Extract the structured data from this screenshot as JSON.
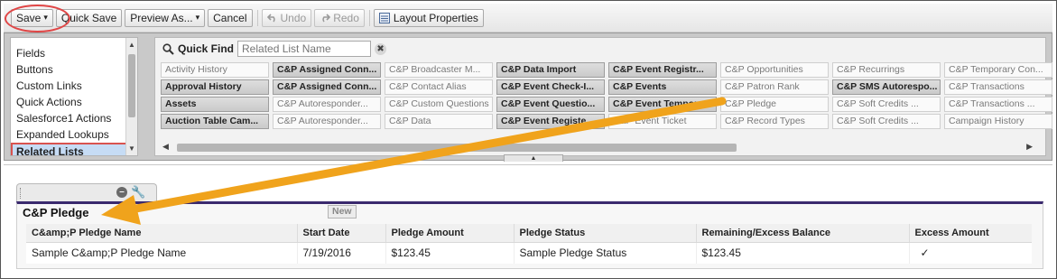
{
  "toolbar": {
    "save": "Save",
    "save_caret": "▾",
    "quick_save": "Quick Save",
    "preview_as": "Preview As...",
    "preview_caret": "▾",
    "cancel": "Cancel",
    "undo": "Undo",
    "redo": "Redo",
    "layout_properties": "Layout Properties"
  },
  "categories": [
    "Fields",
    "Buttons",
    "Custom Links",
    "Quick Actions",
    "Salesforce1 Actions",
    "Expanded Lookups",
    "Related Lists"
  ],
  "selected_category": "Related Lists",
  "quick_find": {
    "label": "Quick Find",
    "placeholder": "Related List Name"
  },
  "related_list_grid": [
    [
      "Activity History",
      "Approval History",
      "Assets",
      "Auction Table Cam..."
    ],
    [
      "C&P Assigned Conn...",
      "C&P Assigned Conn...",
      "C&P Autoresponder...",
      "C&P Autoresponder..."
    ],
    [
      "C&P Broadcaster M...",
      "C&P Contact Alias",
      "C&P Custom Questions",
      "C&P Data"
    ],
    [
      "C&P Data Import",
      "C&P Event Check-I...",
      "C&P Event Questio...",
      "C&P Event Registe..."
    ],
    [
      "C&P Event Registr...",
      "C&P Events",
      "C&P Event Tempora...",
      "C&P Event Ticket"
    ],
    [
      "C&P Opportunities",
      "C&P Patron Rank",
      "C&P Pledge",
      "C&P Record Types"
    ],
    [
      "C&P Recurrings",
      "C&P SMS Autorespo...",
      "C&P Soft Credits ...",
      "C&P Soft Credits ..."
    ],
    [
      "C&P Temporary Con...",
      "C&P Transactions",
      "C&P Transactions ...",
      "Campaign History"
    ]
  ],
  "related_list_used": [
    [
      false,
      true,
      true,
      true
    ],
    [
      true,
      true,
      false,
      false
    ],
    [
      false,
      false,
      false,
      false
    ],
    [
      true,
      true,
      true,
      true
    ],
    [
      true,
      true,
      true,
      false
    ],
    [
      false,
      false,
      false,
      false
    ],
    [
      false,
      true,
      false,
      false
    ],
    [
      false,
      false,
      false,
      false
    ]
  ],
  "section": {
    "title": "C&P Pledge",
    "new_button": "New",
    "columns": [
      "C&amp;P Pledge Name",
      "Start Date",
      "Pledge Amount",
      "Pledge Status",
      "Remaining/Excess Balance",
      "Excess Amount"
    ],
    "row": [
      "Sample C&amp;P Pledge Name",
      "7/19/2016",
      "$123.45",
      "Sample Pledge Status",
      "$123.45",
      "✓"
    ]
  },
  "colors": {
    "highlight_red": "#e04545",
    "arrow_orange": "#f0a31c",
    "section_bar": "#3a2a6e",
    "selected_bg": "#c6dcf5"
  },
  "icons": [
    "dropdown-caret-icon",
    "undo-icon",
    "redo-icon",
    "layout-properties-icon",
    "search-icon",
    "clear-icon",
    "remove-icon",
    "wrench-icon",
    "checkmark-icon",
    "annotation-arrow"
  ]
}
